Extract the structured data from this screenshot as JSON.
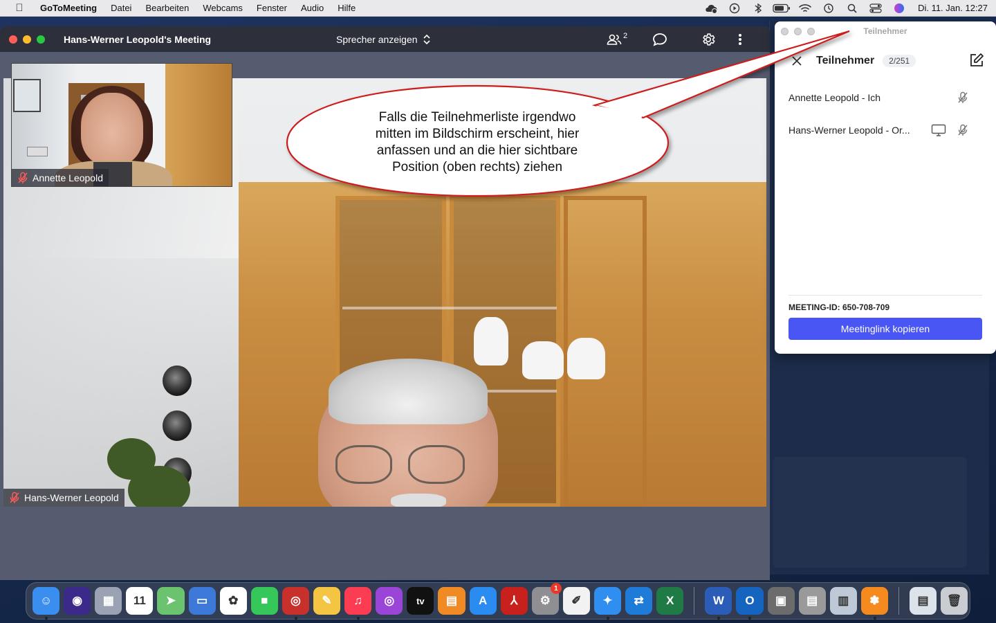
{
  "menubar": {
    "app_name": "GoToMeeting",
    "items": [
      "Datei",
      "Bearbeiten",
      "Webcams",
      "Fenster",
      "Audio",
      "Hilfe"
    ],
    "status_icons": [
      "cloud-icon",
      "play-circle-icon",
      "bluetooth-icon",
      "battery-icon",
      "wifi-icon",
      "time-machine-icon",
      "search-icon",
      "control-center-icon",
      "siri-icon"
    ],
    "clock": "Di. 11. Jan.  12:27"
  },
  "meeting": {
    "title": "Hans-Werner Leopold's Meeting",
    "view_mode": "Sprecher anzeigen",
    "participants_count": "2",
    "main_speaker": "Hans-Werner Leopold",
    "thumbnail_speaker": "Annette Leopold"
  },
  "callout": {
    "lines": [
      "Falls die Teilnehmerliste irgendwo",
      "mitten im Bildschirm erscheint, hier",
      "anfassen und an die hier sichtbare",
      "Position (oben rechts) ziehen"
    ]
  },
  "panel": {
    "window_title": "Teilnehmer",
    "heading": "Teilnehmer",
    "count": "2/251",
    "participants": [
      {
        "name": "Annette Leopold - Ich",
        "screen": false
      },
      {
        "name": "Hans-Werner Leopold - Or...",
        "screen": true
      }
    ],
    "meeting_id": "MEETING-ID: 650-708-709",
    "copy_link_label": "Meetinglink kopieren",
    "accent": "#4a56f3"
  },
  "dock": {
    "apps": [
      {
        "name": "finder",
        "color": "#3a8ef0",
        "glyph": "☺",
        "running": true
      },
      {
        "name": "siri",
        "color": "#3b2a8a",
        "glyph": "◉",
        "running": false
      },
      {
        "name": "launchpad",
        "color": "#9aa2b3",
        "glyph": "▦",
        "running": false
      },
      {
        "name": "calendar",
        "color": "#ffffff",
        "glyph": "11",
        "running": false
      },
      {
        "name": "maps",
        "color": "#6bc36f",
        "glyph": "➤",
        "running": false
      },
      {
        "name": "keynote",
        "color": "#3c79d9",
        "glyph": "▭",
        "running": false
      },
      {
        "name": "photos",
        "color": "#ffffff",
        "glyph": "✿",
        "running": false
      },
      {
        "name": "facetime",
        "color": "#35c759",
        "glyph": "■",
        "running": false
      },
      {
        "name": "photo-booth",
        "color": "#c8302c",
        "glyph": "◎",
        "running": true
      },
      {
        "name": "pages",
        "color": "#f4c542",
        "glyph": "✎",
        "running": false
      },
      {
        "name": "music",
        "color": "#fb3c52",
        "glyph": "♫",
        "running": true
      },
      {
        "name": "podcasts",
        "color": "#9b44d8",
        "glyph": "◎",
        "running": false
      },
      {
        "name": "tv",
        "color": "#111111",
        "glyph": "tv",
        "running": false
      },
      {
        "name": "books",
        "color": "#f08a24",
        "glyph": "▤",
        "running": false
      },
      {
        "name": "app-store",
        "color": "#2a8cf0",
        "glyph": "A",
        "running": false
      },
      {
        "name": "acrobat",
        "color": "#c8201c",
        "glyph": "⅄",
        "running": false
      },
      {
        "name": "system-preferences",
        "color": "#8e8e93",
        "glyph": "⚙",
        "running": false,
        "badge": "1"
      },
      {
        "name": "textedit",
        "color": "#f2f2f2",
        "glyph": "✐",
        "running": false
      },
      {
        "name": "safari",
        "color": "#2f8ef0",
        "glyph": "✦",
        "running": true
      },
      {
        "name": "teamviewer",
        "color": "#1f7bd8",
        "glyph": "⇄",
        "running": false
      },
      {
        "name": "excel",
        "color": "#1f7a45",
        "glyph": "X",
        "running": false
      }
    ],
    "apps_right": [
      {
        "name": "word",
        "color": "#2b5cb8",
        "glyph": "W",
        "running": true
      },
      {
        "name": "outlook",
        "color": "#1565c0",
        "glyph": "O",
        "running": true
      },
      {
        "name": "printer",
        "color": "#6c6c6c",
        "glyph": "▣",
        "running": false
      },
      {
        "name": "scanner",
        "color": "#9a9a9a",
        "glyph": "▤",
        "running": false
      },
      {
        "name": "preview",
        "color": "#bfc8d6",
        "glyph": "▥",
        "running": false
      },
      {
        "name": "gotomeeting",
        "color": "#f58a1f",
        "glyph": "✽",
        "running": true
      }
    ],
    "trash_items": [
      {
        "name": "downloads-stack",
        "color": "#dde3ea",
        "glyph": "▤"
      },
      {
        "name": "trash",
        "color": "#c9cdd2",
        "glyph": "🗑"
      }
    ]
  }
}
